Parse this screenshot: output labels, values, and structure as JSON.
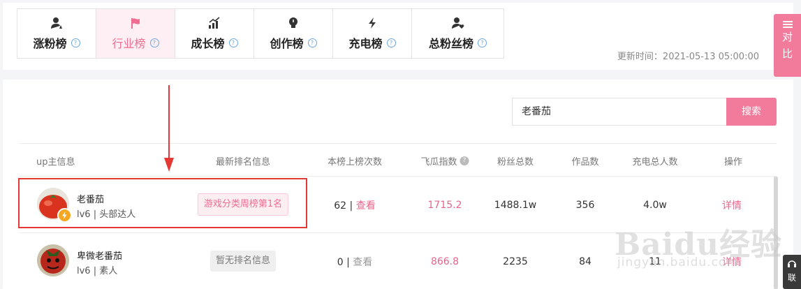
{
  "tabs": [
    {
      "label": "涨粉榜",
      "icon": "user-up-icon",
      "active": false
    },
    {
      "label": "行业榜",
      "icon": "flag-icon",
      "active": true
    },
    {
      "label": "成长榜",
      "icon": "growth-bars-icon",
      "active": false
    },
    {
      "label": "创作榜",
      "icon": "lightbulb-icon",
      "active": false
    },
    {
      "label": "充电榜",
      "icon": "lightning-icon",
      "active": false
    },
    {
      "label": "总粉丝榜",
      "icon": "user-heart-icon",
      "active": false
    }
  ],
  "tab_help_glyph": "?",
  "update_time": "更新时间：2021-05-13 05:00:00",
  "compare": {
    "chars": [
      "对",
      "比"
    ]
  },
  "search": {
    "value": "老番茄",
    "button": "搜索"
  },
  "table": {
    "headers": {
      "up_info": "up主信息",
      "latest_rank": "最新排名信息",
      "times_on_list": "本榜上榜次数",
      "feigua_index": "飞瓜指数",
      "fans_total": "粉丝总数",
      "works": "作品数",
      "charge_total": "充电总人数",
      "actions": "操作"
    },
    "rows": [
      {
        "name": "老番茄",
        "level": "lv6 | 头部达人",
        "rank_info": "游戏分类周榜第1名",
        "times": "62",
        "view": "查看",
        "feigua": "1715.2",
        "fans": "1488.1w",
        "works": "356",
        "charge": "4.0w",
        "detail": "详情"
      },
      {
        "name": "卑微老番茄",
        "level": "lv6 | 素人",
        "rank_info": "暂无排名信息",
        "times": "0",
        "view": "查看",
        "feigua": "866.8",
        "fans": "2235",
        "works": "84",
        "charge": "11",
        "detail": "详情"
      }
    ]
  },
  "contact": {
    "char": "联"
  },
  "watermark": {
    "main": "Baidu经验",
    "sub": "jingyan.baidu.com"
  },
  "colors": {
    "accent": "#f27b9c",
    "highlight_box": "#e53935",
    "tab_active_bg": "#fdeff3"
  }
}
